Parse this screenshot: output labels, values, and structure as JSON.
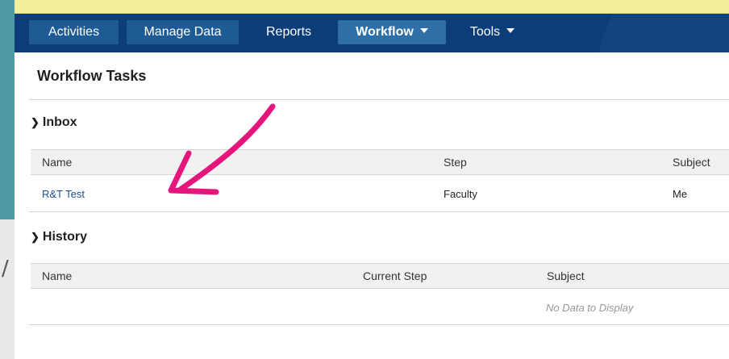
{
  "nav": {
    "items": [
      {
        "label": "Activities"
      },
      {
        "label": "Manage Data"
      },
      {
        "label": "Reports"
      },
      {
        "label": "Workflow"
      },
      {
        "label": "Tools"
      }
    ]
  },
  "page": {
    "title": "Workflow Tasks"
  },
  "inbox": {
    "heading": "Inbox",
    "columns": [
      "Name",
      "Step",
      "Subject"
    ],
    "rows": [
      {
        "name": "R&T Test",
        "step": "Faculty",
        "subject": "Me"
      }
    ]
  },
  "history": {
    "heading": "History",
    "columns": [
      "Name",
      "Current Step",
      "Subject"
    ],
    "empty_text": "No Data to Display"
  },
  "backdrop": {
    "glyph": "/"
  },
  "colors": {
    "nav_bg": "#0d3d78",
    "annotation_arrow": "#e6157c",
    "link": "#1d4f8f"
  }
}
